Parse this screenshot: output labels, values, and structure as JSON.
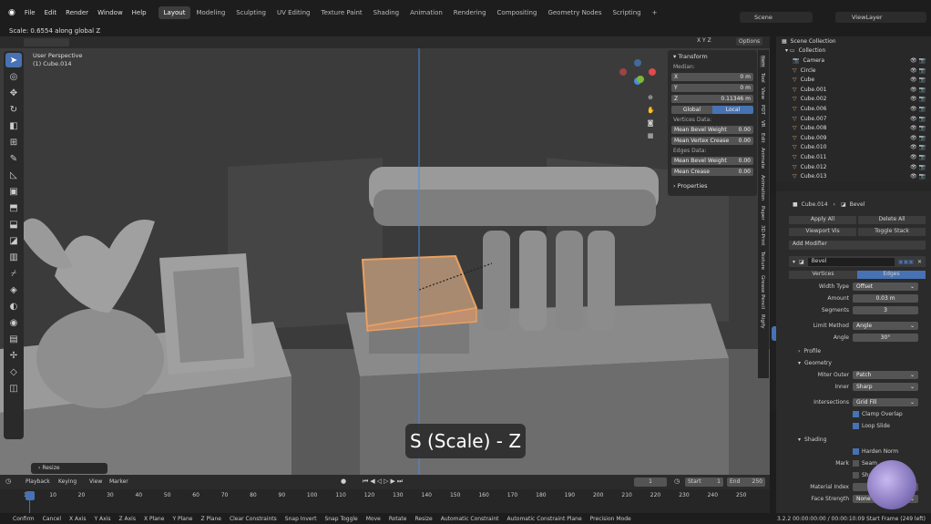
{
  "menubar": {
    "menus": [
      "File",
      "Edit",
      "Render",
      "Window",
      "Help"
    ],
    "workspaces": [
      "Layout",
      "Modeling",
      "Sculpting",
      "UV Editing",
      "Texture Paint",
      "Shading",
      "Animation",
      "Rendering",
      "Compositing",
      "Geometry Nodes",
      "Scripting"
    ],
    "active_workspace": "Layout",
    "scene_label": "Scene",
    "view_layer_label": "ViewLayer"
  },
  "status_hint": "Scale: 0.6554 along global Z",
  "viewport": {
    "perspective_label": "User Perspective",
    "object_label": "(1) Cube.014",
    "options_label": "Options",
    "axis_label": "X Y Z",
    "resize_panel": "Resize",
    "caption": "S (Scale) - Z"
  },
  "npanel": {
    "header": "Transform",
    "median_label": "Median:",
    "x_label": "X",
    "x_value": "0 m",
    "y_label": "Y",
    "y_value": "0 m",
    "z_label": "Z",
    "z_value": "0.11346 m",
    "global_label": "Global",
    "local_label": "Local",
    "vertices_data": "Vertices Data:",
    "mean_bevel_weight_label": "Mean Bevel Weight",
    "mean_bevel_weight_value": "0.00",
    "mean_vertex_crease_label": "Mean Vertex Crease",
    "mean_vertex_crease_value": "0.00",
    "edges_data": "Edges Data:",
    "edge_bevel_weight_label": "Mean Bevel Weight",
    "edge_bevel_weight_value": "0.00",
    "mean_crease_label": "Mean Crease",
    "mean_crease_value": "0.00",
    "properties_label": "Properties"
  },
  "sidetabs": [
    "Item",
    "Tool",
    "View",
    "PDT",
    "VR",
    "Edit",
    "Animate",
    "Animation",
    "Paper",
    "3D-Print",
    "Texture",
    "Grease Pencil",
    "Rigify"
  ],
  "outliner": {
    "root": "Scene Collection",
    "collection": "Collection",
    "items": [
      "Camera",
      "Circle",
      "Cube",
      "Cube.001",
      "Cube.002",
      "Cube.006",
      "Cube.007",
      "Cube.008",
      "Cube.009",
      "Cube.010",
      "Cube.011",
      "Cube.012",
      "Cube.013"
    ]
  },
  "properties": {
    "breadcrumb_object": "Cube.014",
    "breadcrumb_modifier": "Bevel",
    "apply_all": "Apply All",
    "delete_all": "Delete All",
    "viewport_vis": "Viewport Vis",
    "toggle_stack": "Toggle Stack",
    "add_modifier": "Add Modifier",
    "modifier_name": "Bevel",
    "vertices_tab": "Vertices",
    "edges_tab": "Edges",
    "width_type_label": "Width Type",
    "width_type_value": "Offset",
    "amount_label": "Amount",
    "amount_value": "0.03 m",
    "segments_label": "Segments",
    "segments_value": "3",
    "limit_method_label": "Limit Method",
    "limit_method_value": "Angle",
    "angle_label": "Angle",
    "angle_value": "30°",
    "profile_label": "Profile",
    "geometry_label": "Geometry",
    "miter_outer_label": "Miter Outer",
    "miter_outer_value": "Patch",
    "inner_label": "Inner",
    "inner_value": "Sharp",
    "intersections_label": "Intersections",
    "intersections_value": "Grid Fill",
    "clamp_overlap": "Clamp Overlap",
    "loop_slide": "Loop Slide",
    "shading_label": "Shading",
    "harden_normals": "Harden Norm",
    "mark_label": "Mark",
    "seam": "Seam",
    "sharp": "Sharp",
    "material_index_label": "Material Index",
    "face_strength_label": "Face Strength",
    "face_strength_value": "None"
  },
  "timeline": {
    "playback": "Playback",
    "keying": "Keying",
    "view": "View",
    "marker": "Marker",
    "current_frame": "1",
    "start_label": "Start",
    "start_value": "1",
    "end_label": "End",
    "end_value": "250",
    "ticks": [
      "1",
      "10",
      "20",
      "30",
      "40",
      "50",
      "60",
      "70",
      "80",
      "90",
      "100",
      "110",
      "120",
      "130",
      "140",
      "150",
      "160",
      "170",
      "180",
      "190",
      "200",
      "210",
      "220",
      "230",
      "240",
      "250"
    ]
  },
  "footer": {
    "items": [
      "Confirm",
      "Cancel",
      "X Axis",
      "Y Axis",
      "Z Axis",
      "X Plane",
      "Y Plane",
      "Z Plane",
      "Clear Constraints",
      "Snap Invert",
      "Snap Toggle",
      "Move",
      "Rotate",
      "Resize",
      "Automatic Constraint",
      "Automatic Constraint Plane",
      "Precision Mode"
    ],
    "version": "3.2.2  00:00:00:00 / 00:00:10:09  Start Frame (249 left)"
  },
  "colors": {
    "accent": "#4772b3",
    "selected_object": "#e8a060",
    "x_axis": "#e04a4a",
    "y_axis": "#7fb832",
    "z_axis": "#4a8ae0"
  }
}
